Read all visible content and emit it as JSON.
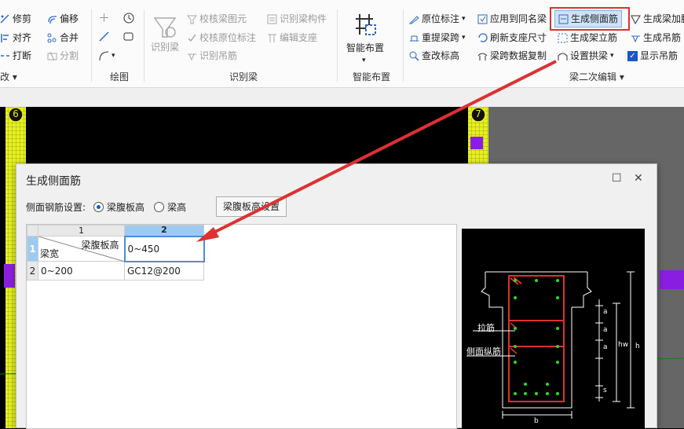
{
  "ribbon": {
    "col1": {
      "edit": "修剪",
      "align": "对齐",
      "break": "打断"
    },
    "col2": {
      "offset": "偏移",
      "merge": "合并",
      "split": "分割"
    },
    "draw": {
      "group": "绘图"
    },
    "recognize": {
      "recognize_beam": "识别梁",
      "check_beam_element": "校核梁图元",
      "check_inplace_mark": "校核原位标注",
      "recognize_hanger": "识别吊筋",
      "recognize_beam_member": "识别梁构件",
      "edit_support": "编辑支座",
      "group": "识别梁"
    },
    "smart": {
      "label": "智能布置",
      "group": "智能布置"
    },
    "beam_edit": {
      "inplace_mark": "原位标注",
      "apply_same_name": "应用到同名梁",
      "gen_side_rebar": "生成侧面筋",
      "gen_beam_extra": "生成梁加腋",
      "lift_span": "重提梁跨",
      "refresh_support": "刷新支座尺寸",
      "gen_erect_rebar": "生成架立筋",
      "gen_hanger": "生成吊筋",
      "check_elevation": "查改标高",
      "copy_span_data": "梁跨数据复制",
      "set_arch_beam": "设置拱梁",
      "show_hanger": "显示吊筋",
      "group": "梁二次编辑"
    },
    "left_group_suffix": "改"
  },
  "axis_labels": {
    "a": "6",
    "b": "7"
  },
  "dialog": {
    "title": "生成侧面筋",
    "setting_label": "侧面钢筋设置:",
    "radio_web": "梁腹板高",
    "radio_height": "梁高",
    "button_web_setting": "梁腹板高设置",
    "table": {
      "col_headers": [
        "1",
        "2"
      ],
      "row_headers": [
        "1",
        "2"
      ],
      "header_cell_top": "梁腹板高",
      "header_cell_bottom": "梁宽",
      "rows": [
        {
          "c1": "0~200",
          "c2": "GC12@200"
        }
      ],
      "header_col2_value": "0~450"
    }
  },
  "preview": {
    "tie_label": "拉筋",
    "side_bar_label": "侧面纵筋",
    "dim_a": "a",
    "dim_s": "s",
    "dim_hw": "hw",
    "dim_h": "h",
    "dim_b": "b"
  },
  "colors": {
    "accent": "#1a56c8",
    "highlight": "#e03030",
    "canvas": "#000000"
  }
}
